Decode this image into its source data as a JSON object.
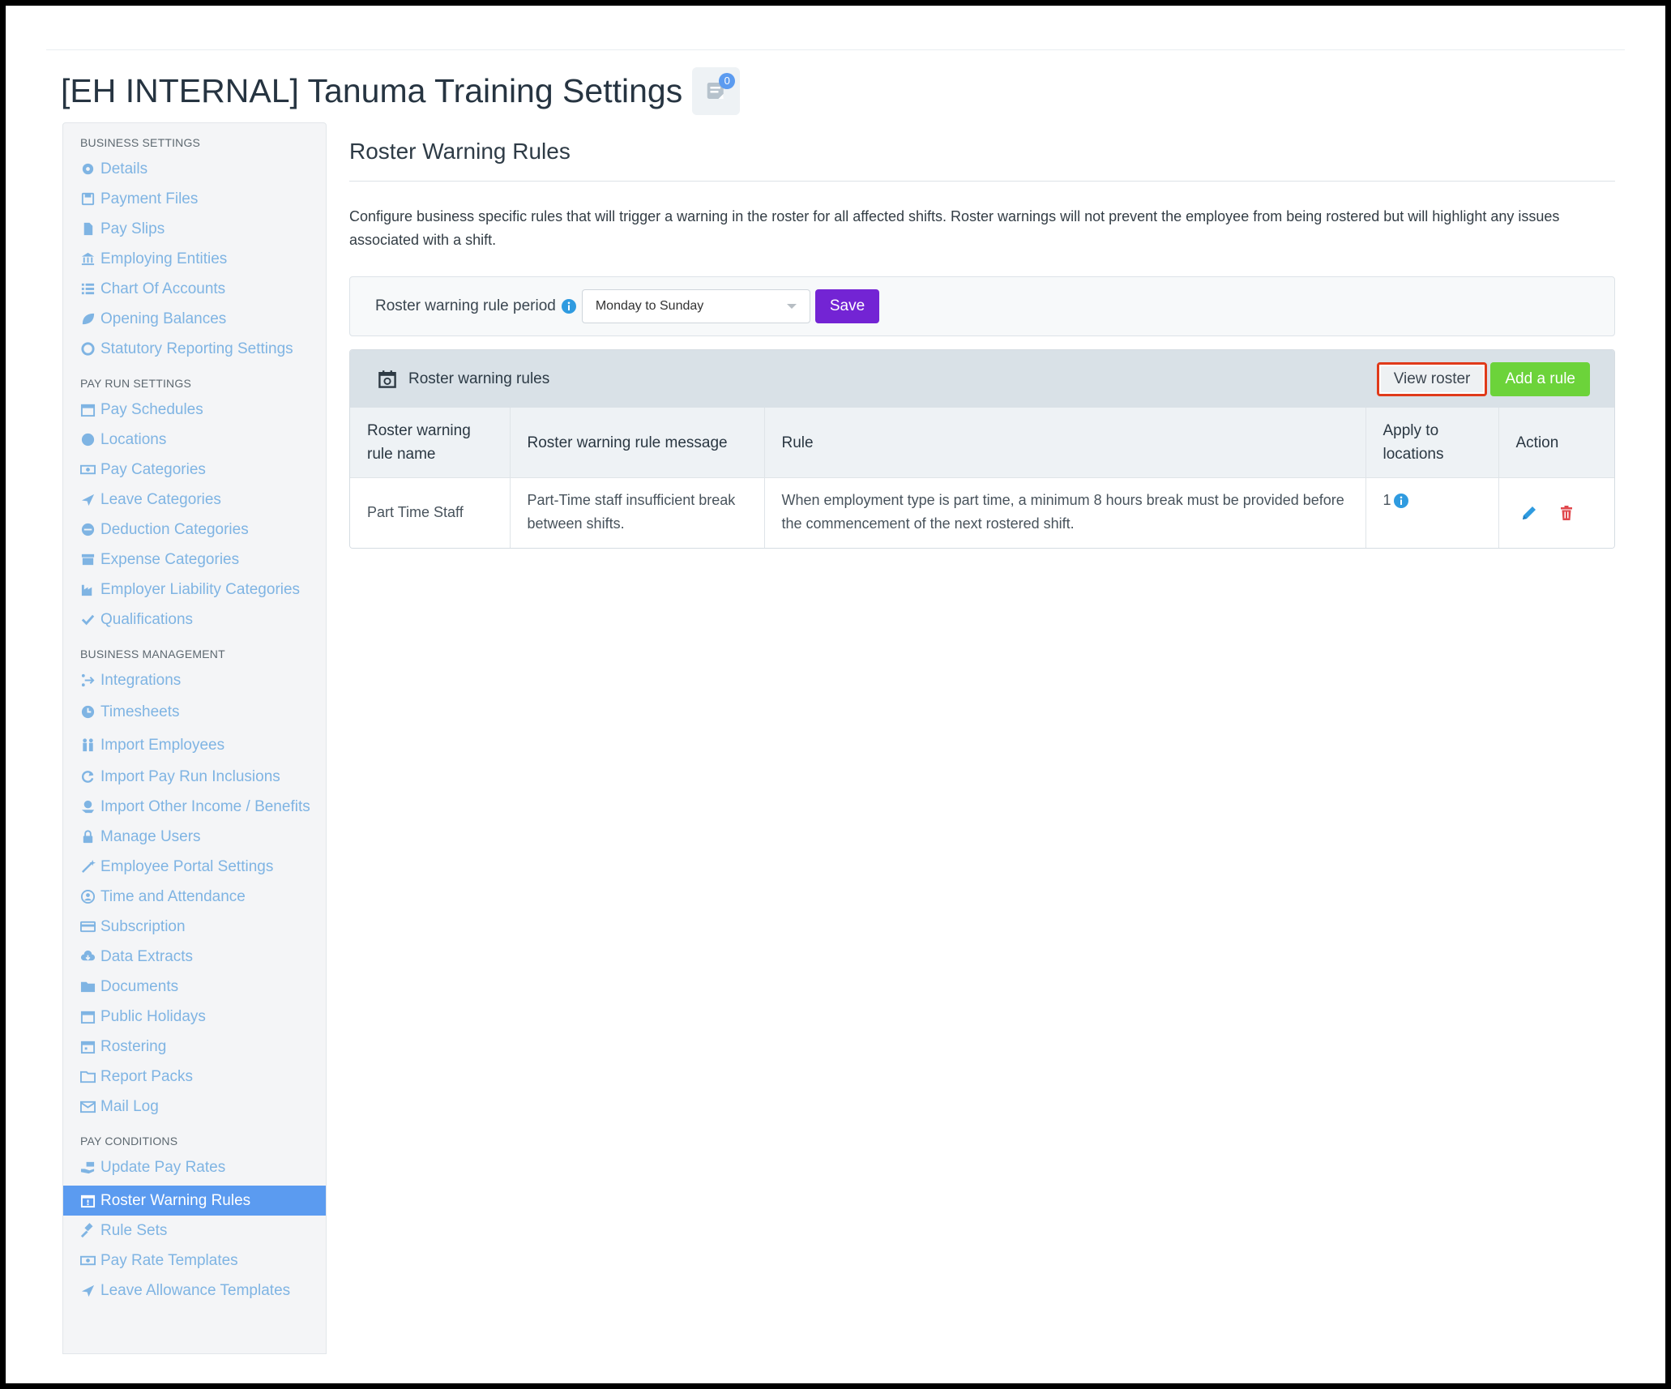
{
  "page": {
    "title": "[EH INTERNAL] Tanuma Training Settings",
    "notes_count": "0"
  },
  "sidebar": {
    "sections": [
      {
        "label": "BUSINESS SETTINGS",
        "items": [
          "Details",
          "Payment Files",
          "Pay Slips",
          "Employing Entities",
          "Chart Of Accounts",
          "Opening Balances",
          "Statutory Reporting Settings"
        ]
      },
      {
        "label": "PAY RUN SETTINGS",
        "items": [
          "Pay Schedules",
          "Locations",
          "Pay Categories",
          "Leave Categories",
          "Deduction Categories",
          "Expense Categories",
          "Employer Liability Categories",
          "Qualifications"
        ]
      },
      {
        "label": "BUSINESS MANAGEMENT",
        "items": [
          "Integrations",
          "Timesheets",
          "Import Employees",
          "Import Pay Run Inclusions",
          "Import Other Income / Benefits",
          "Manage Users",
          "Employee Portal Settings",
          "Time and Attendance",
          "Subscription",
          "Data Extracts",
          "Documents",
          "Public Holidays",
          "Rostering",
          "Report Packs",
          "Mail Log"
        ]
      },
      {
        "label": "PAY CONDITIONS",
        "items": [
          "Update Pay Rates",
          "Roster Warning Rules",
          "Rule Sets",
          "Pay Rate Templates",
          "Leave Allowance Templates"
        ]
      }
    ],
    "active_item": "Roster Warning Rules"
  },
  "main": {
    "section_title": "Roster Warning Rules",
    "description": "Configure business specific rules that will trigger a warning in the roster for all affected shifts. Roster warnings will not prevent the employee from being rostered but will highlight any issues associated with a shift.",
    "period": {
      "label": "Roster warning rule period",
      "selected": "Monday to Sunday",
      "save_label": "Save"
    },
    "rules_panel": {
      "title": "Roster warning rules",
      "view_roster_label": "View roster",
      "add_rule_label": "Add a rule",
      "columns": [
        "Roster warning rule name",
        "Roster warning rule message",
        "Rule",
        "Apply to locations",
        "Action"
      ],
      "rows": [
        {
          "name": "Part Time Staff",
          "message": "Part-Time staff insufficient break between shifts.",
          "rule": "When employment type is part time, a minimum 8 hours break must be provided before the commencement of the next rostered shift.",
          "locations": "1"
        }
      ]
    }
  },
  "colors": {
    "accent_blue": "#5b9bf0",
    "link_blue": "#7fb4e3",
    "save_purple": "#7324d4",
    "add_green": "#6cd33a",
    "highlight_red": "#e03a1a",
    "delete_red": "#e0474c"
  }
}
